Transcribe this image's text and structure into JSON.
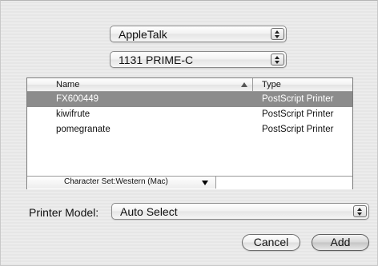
{
  "transport_popup": {
    "value": "AppleTalk"
  },
  "zone_popup": {
    "value": "1131 PRIME-C"
  },
  "printer_list": {
    "columns": {
      "name": "Name",
      "type": "Type"
    },
    "rows": [
      {
        "name": "FX600449",
        "type": "PostScript Printer",
        "selected": true
      },
      {
        "name": "kiwifrute",
        "type": "PostScript Printer",
        "selected": false
      },
      {
        "name": "pomegranate",
        "type": "PostScript Printer",
        "selected": false
      }
    ],
    "character_set": "Character Set:Western (Mac)"
  },
  "printer_model": {
    "label": "Printer Model:",
    "value": "Auto Select"
  },
  "buttons": {
    "cancel": "Cancel",
    "add": "Add"
  },
  "colors": {
    "selection": "#8c8c8c",
    "background": "#ebebeb"
  },
  "icons": [
    "stepper-arrows-icon",
    "sort-ascending-icon",
    "dropdown-triangle-icon"
  ]
}
